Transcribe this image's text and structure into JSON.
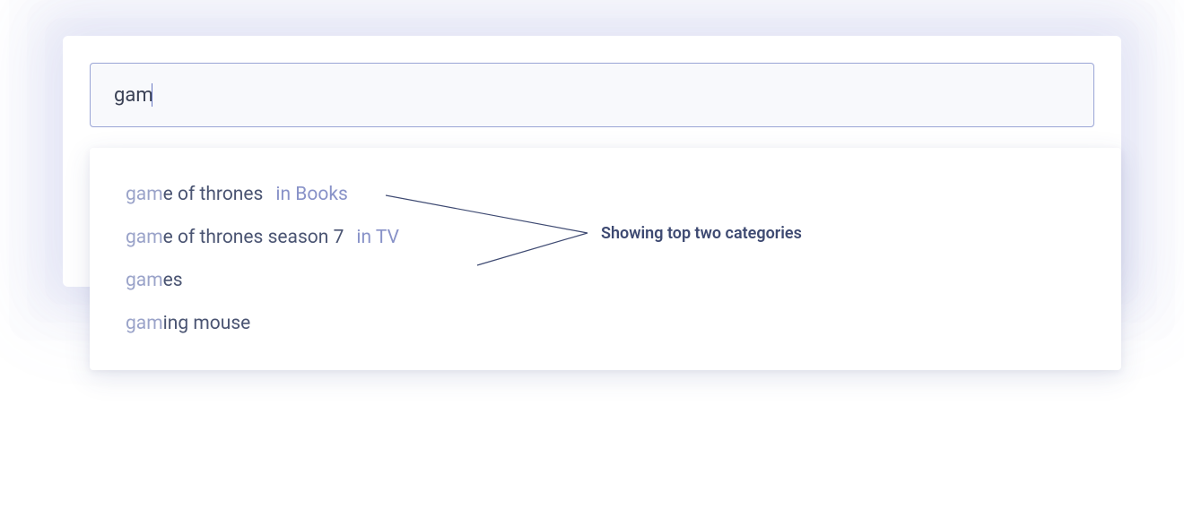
{
  "search": {
    "value": "gam"
  },
  "suggestions": [
    {
      "match": "gam",
      "rest": "e of thrones",
      "category": "in Books"
    },
    {
      "match": "gam",
      "rest": "e of thrones season 7",
      "category": "in TV"
    },
    {
      "match": "gam",
      "rest": "es",
      "category": ""
    },
    {
      "match": "gam",
      "rest": "ing mouse",
      "category": ""
    }
  ],
  "annotation": {
    "label": "Showing top two categories"
  }
}
